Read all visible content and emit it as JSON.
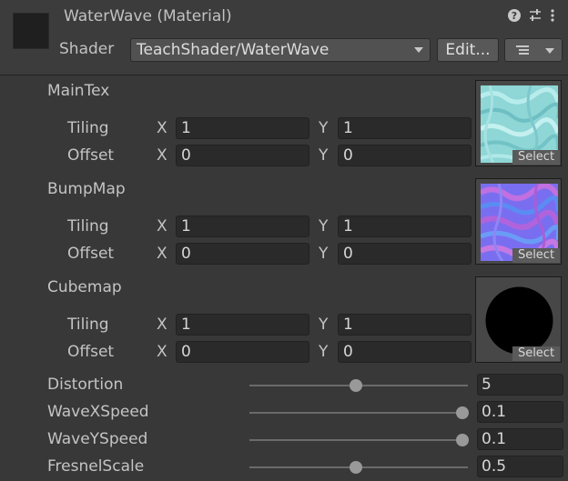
{
  "header": {
    "title": "WaterWave (Material)",
    "shader_label": "Shader",
    "shader_value": "TeachShader/WaterWave",
    "edit_label": "Edit...",
    "help_icon": "help-icon",
    "preset_icon": "sliders-icon",
    "more_icon": "kebab-menu-icon"
  },
  "textures": [
    {
      "name": "MainTex",
      "tiling_label": "Tiling",
      "offset_label": "Offset",
      "x_label": "X",
      "y_label": "Y",
      "tiling_x": "1",
      "tiling_y": "1",
      "offset_x": "0",
      "offset_y": "0",
      "select_label": "Select"
    },
    {
      "name": "BumpMap",
      "tiling_label": "Tiling",
      "offset_label": "Offset",
      "x_label": "X",
      "y_label": "Y",
      "tiling_x": "1",
      "tiling_y": "1",
      "offset_x": "0",
      "offset_y": "0",
      "select_label": "Select"
    },
    {
      "name": "Cubemap",
      "tiling_label": "Tiling",
      "offset_label": "Offset",
      "x_label": "X",
      "y_label": "Y",
      "tiling_x": "1",
      "tiling_y": "1",
      "offset_x": "0",
      "offset_y": "0",
      "select_label": "Select"
    }
  ],
  "sliders": [
    {
      "label": "Distortion",
      "value": "5",
      "fraction": 0.5
    },
    {
      "label": "WaveXSpeed",
      "value": "0.1",
      "fraction": 1.0
    },
    {
      "label": "WaveYSpeed",
      "value": "0.1",
      "fraction": 1.0
    },
    {
      "label": "FresnelScale",
      "value": "0.5",
      "fraction": 0.5
    }
  ],
  "colors": {
    "background": "#383838",
    "field": "#2a2a2a",
    "text": "#c4c4c4"
  }
}
